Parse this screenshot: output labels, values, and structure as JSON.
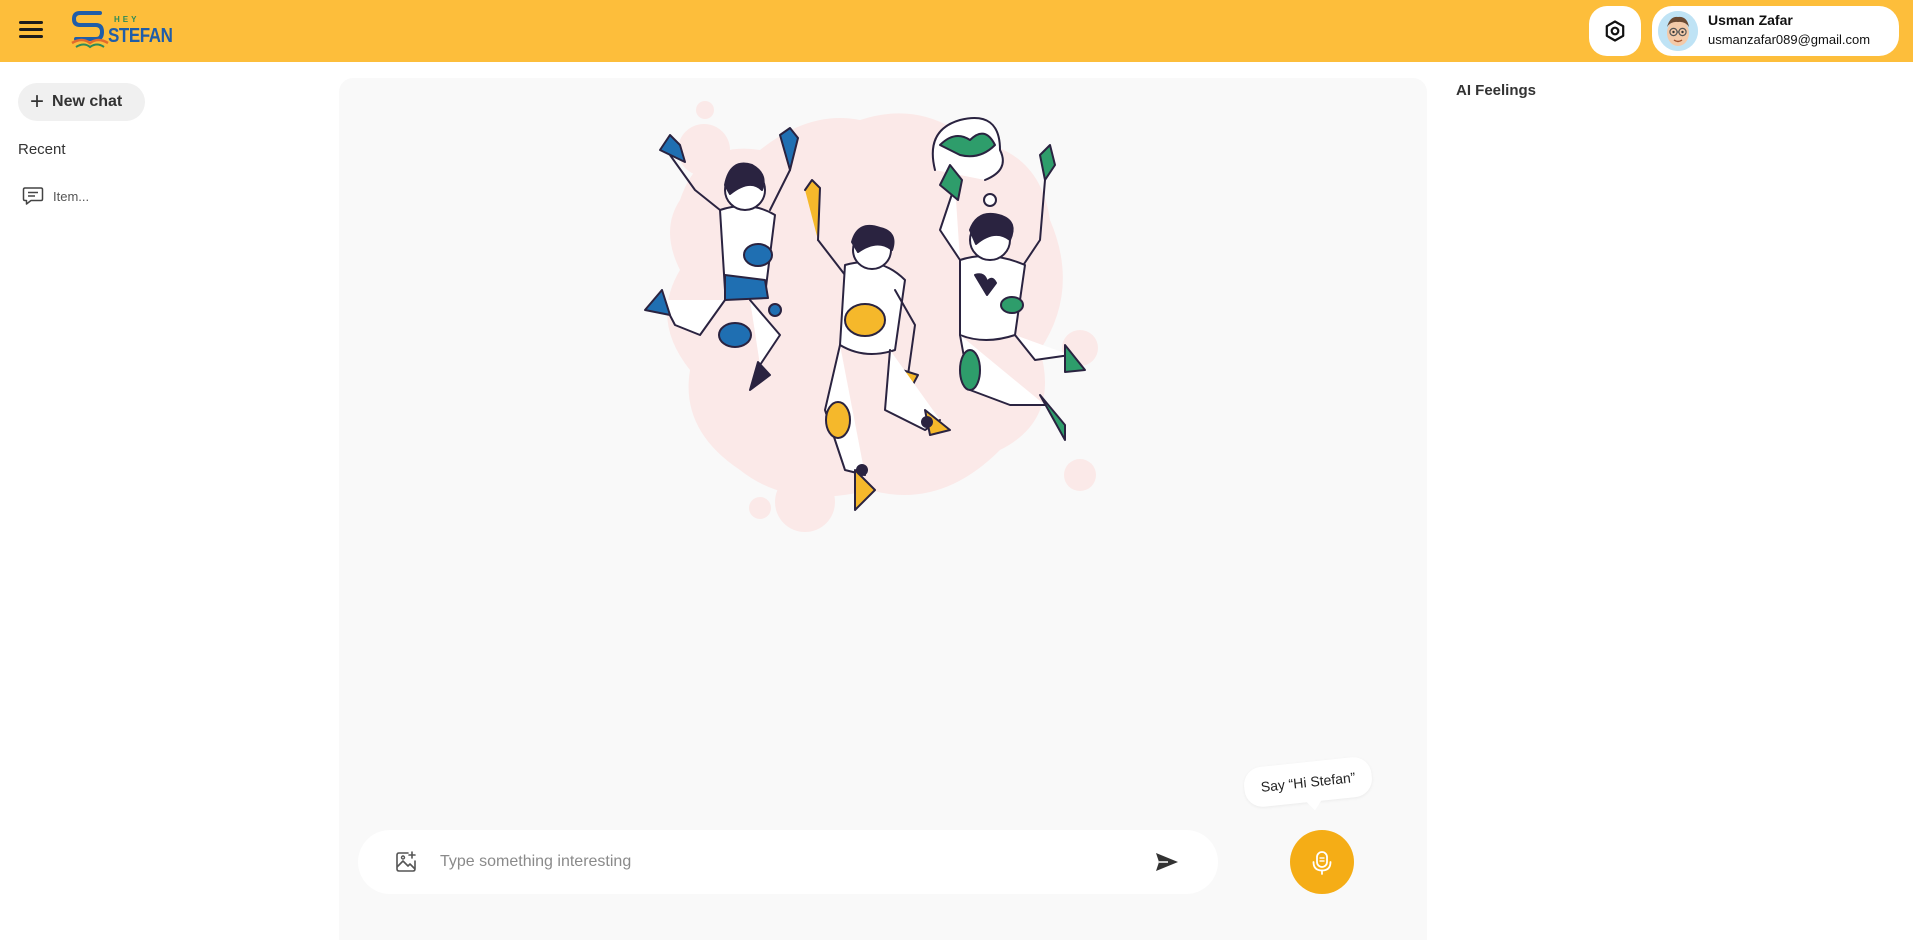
{
  "header": {
    "logo_small": "HEY",
    "logo_text": "STEFAN",
    "user_name": "Usman Zafar",
    "user_email": "usmanzafar089@gmail.com"
  },
  "sidebar": {
    "new_chat_label": "New chat",
    "recent_title": "Recent",
    "recent_items": [
      {
        "label": "Item..."
      }
    ]
  },
  "chat": {
    "input_placeholder": "Type something interesting",
    "input_value": "",
    "wake_prompt": "Say “Hi Stefan”"
  },
  "right_panel": {
    "title": "AI Feelings"
  },
  "colors": {
    "topbar": "#fdbe3b",
    "accent": "#f5ad16",
    "panel_bg": "#f9f9f9"
  },
  "icons": {
    "menu": "hamburger-menu-icon",
    "settings": "settings-hexagon-icon",
    "new_chat": "plus-icon",
    "chat_item": "chat-bubble-icon",
    "attach": "image-add-icon",
    "send": "send-arrow-icon",
    "mic": "microphone-icon"
  }
}
